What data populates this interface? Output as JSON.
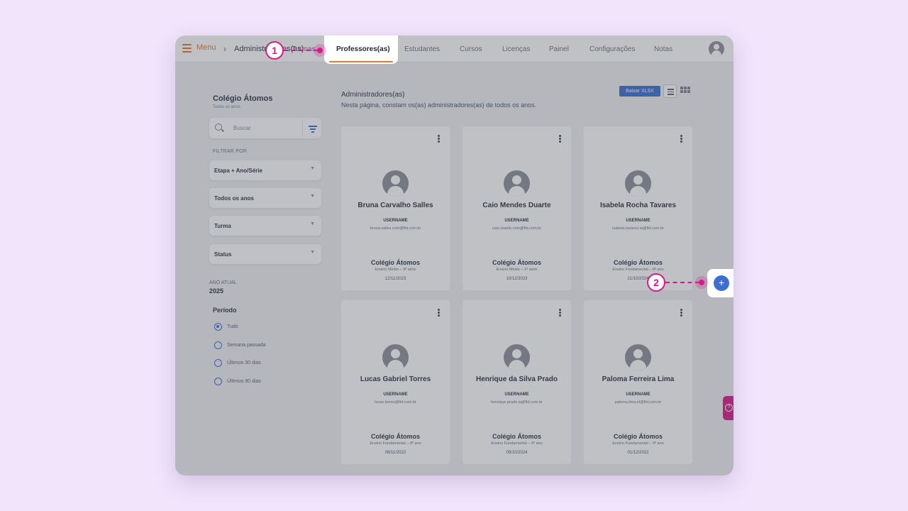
{
  "topbar": {
    "menu_label": "Menu",
    "breadcrumb": "Administradores(as)",
    "tabs": [
      "Turmas",
      "Professores(as)",
      "Estudantes",
      "Cursos",
      "Licenças",
      "Painel",
      "Configurações",
      "Notas"
    ],
    "active_tab": "Professores(as)"
  },
  "sidebar": {
    "school": "Colégio Átomos",
    "school_sub": "Todos os anos",
    "search_placeholder": "Buscar",
    "filter_by": "FILTRAR POR",
    "selects": [
      "Etapa + Ano/Série",
      "Todos os anos",
      "Turma",
      "Status"
    ],
    "ano_atual_label": "ANO ATUAL",
    "ano_atual": "2025",
    "periodo_title": "Período",
    "periodos": [
      "Tudo",
      "Semana passada",
      "Últimos 30 dias",
      "Últimos 90 dias"
    ],
    "periodo_selected": "Tudo"
  },
  "main": {
    "title": "Administradores(as)",
    "description": "Nesta página, constam os(as) administradores(as) de todos os anos.",
    "export_button": "Baixar XLSX",
    "username_label": "USERNAME",
    "cards": [
      {
        "name": "Bruna Carvalho Salles",
        "email": "bruna.salles.com@ftd.com.br",
        "school": "Colégio Átomos",
        "stage": "Ensino Médio – 3ª série",
        "date": "12/11/2023"
      },
      {
        "name": "Caio Mendes Duarte",
        "email": "caio.duarte.com@ftd.com.br",
        "school": "Colégio Átomos",
        "stage": "Ensino Médio – 1ª série",
        "date": "10/12/2023"
      },
      {
        "name": "Isabela Rocha Tavares",
        "email": "isabela.tavares.ia@ftd.com.br",
        "school": "Colégio Átomos",
        "stage": "Ensino Fundamental – 8º ano",
        "date": "21/10/2024"
      },
      {
        "name": "Lucas Gabriel Torres",
        "email": "lucas.torres@ftd.com.br",
        "school": "Colégio Átomos",
        "stage": "Ensino Fundamental – 8º ano",
        "date": "08/11/2022"
      },
      {
        "name": "Henrique da Silva Prado",
        "email": "henrique.prado.ia@ftd.com.br",
        "school": "Colégio Átomos",
        "stage": "Ensino Fundamental – 9º ano",
        "date": "05/10/2024"
      },
      {
        "name": "Paloma Ferreira Lima",
        "email": "paloma.lima.el@ftd.com.br",
        "school": "Colégio Átomos",
        "stage": "Ensino Fundamental – 9º ano",
        "date": "01/12/2022"
      }
    ]
  },
  "fab_symbol": "+",
  "help_icon": "question-icon",
  "callouts": [
    "1",
    "2"
  ],
  "colors": {
    "accent_orange": "#e07a2e",
    "primary_blue": "#3b6fd1",
    "callout_pink": "#d81b8a",
    "background": "#f1e4fb"
  }
}
